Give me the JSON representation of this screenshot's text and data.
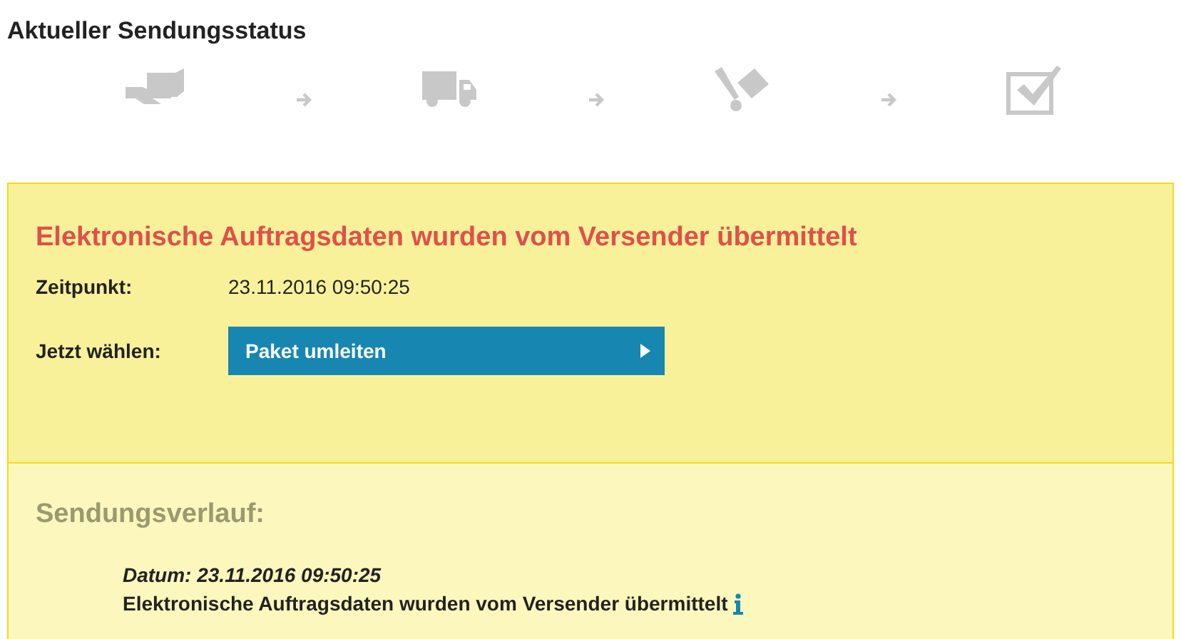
{
  "title": "Aktueller Sendungsstatus",
  "steps": [
    {
      "kind": "handover"
    },
    {
      "kind": "truck"
    },
    {
      "kind": "cart"
    },
    {
      "kind": "check"
    }
  ],
  "status": {
    "heading": "Elektronische Auftragsdaten wurden vom Versender übermittelt",
    "fields": [
      {
        "label": "Zeitpunkt:",
        "value": "23.11.2016 09:50:25"
      }
    ],
    "action": {
      "label": "Jetzt wählen:",
      "button": "Paket umleiten"
    }
  },
  "history": {
    "heading": "Sendungsverlauf:",
    "entries": [
      {
        "date": "Datum: 23.11.2016 09:50:25",
        "text": "Elektronische Auftragsdaten wurden vom Versender übermittelt"
      }
    ]
  }
}
